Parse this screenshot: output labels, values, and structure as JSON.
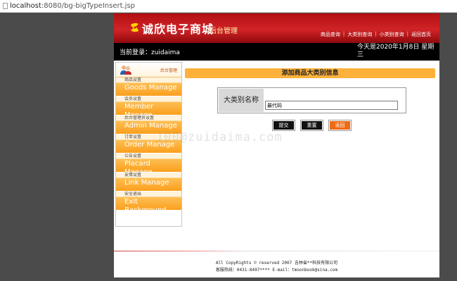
{
  "browser": {
    "url_host": "localhost",
    "url_rest": ":8080/bg-bigTypeInsert.jsp"
  },
  "header": {
    "logo": "诚欣电子商城",
    "subtitle": "后台管理",
    "links": [
      "商品查询",
      "大类别查询",
      "小类别查询",
      "返回首页"
    ]
  },
  "loginbar": {
    "current_user": "当前登录：zuidaima",
    "date_line1": "今天是2020年1月8日 星期",
    "date_line2": "三"
  },
  "menu": {
    "title": "后台管理",
    "items": [
      {
        "cn": "商品设置",
        "en": "Goods Manage"
      },
      {
        "cn": "会员设置",
        "en": "Member Manage"
      },
      {
        "cn": "后台管理员设置",
        "en": "Admin Manage"
      },
      {
        "cn": "订单设置",
        "en": "Order Manage"
      },
      {
        "cn": "公告设置",
        "en": "Placard Manage"
      },
      {
        "cn": "友情设置",
        "en": "Link Manage"
      },
      {
        "cn": "安全退出",
        "en": "Exit Background"
      }
    ]
  },
  "form": {
    "title": "添加商品大类别信息",
    "field_label": "大类别名称",
    "field_value": "最代码",
    "buttons": {
      "submit": "提交",
      "reset": "重置",
      "back": "返回"
    }
  },
  "watermark": "100@zuidaima.com",
  "footer": {
    "line1": "All CopyRights © reserved 2007 吉林省**科技有限公司",
    "line2": "客服热线：0431-8497**** E-mail：tmoonbook@sina.com"
  },
  "colors": {
    "header_red": "#c4161b",
    "accent_orange": "#fdb13a",
    "back_button": "#f06a13"
  }
}
